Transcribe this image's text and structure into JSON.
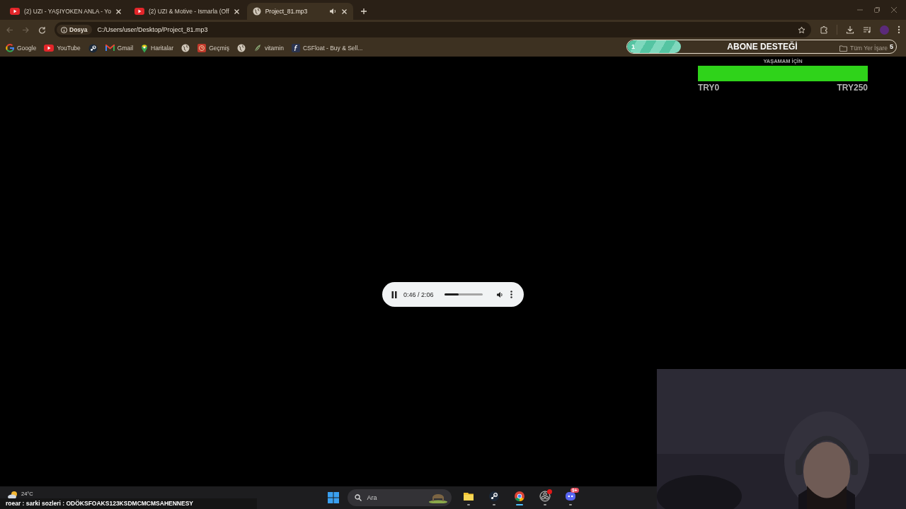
{
  "tabs": [
    {
      "title": "(2) UZI - YAŞIYOKEN ANLA - Yo",
      "kind": "video",
      "selected": false,
      "audio": false
    },
    {
      "title": "(2) UZI & Motive - Ismarla (Off",
      "kind": "video",
      "selected": false,
      "audio": false
    },
    {
      "title": "Project_81.mp3",
      "kind": "file",
      "selected": true,
      "audio": true
    }
  ],
  "address_bar": {
    "chip": "Dosya",
    "url": "C:/Users/user/Desktop/Project_81.mp3"
  },
  "bookmarks": [
    {
      "kind": "google",
      "label": "Google"
    },
    {
      "kind": "video",
      "label": "YouTube"
    },
    {
      "kind": "steam"
    },
    {
      "kind": "mail",
      "label": "Gmail"
    },
    {
      "kind": "pin",
      "label": "Haritalar"
    },
    {
      "kind": "globe"
    },
    {
      "kind": "history",
      "label": "Geçmiş"
    },
    {
      "kind": "globe"
    },
    {
      "kind": "leaf",
      "label": "vitamin"
    },
    {
      "kind": "float",
      "label": "CSFloat - Buy & Sell..."
    }
  ],
  "all_bookmarks": "Tüm Yer İşare",
  "subscriber_goal": {
    "current": "1",
    "title": "ABONE DESTEĞİ",
    "target": "5",
    "level": 0.2
  },
  "donation_goal": {
    "title": "YAŞAMAM İÇİN",
    "level": 1,
    "min": "TRY0",
    "max": "TRY250"
  },
  "player": {
    "playing": true,
    "time": "0:46 / 2:06",
    "level": 0.37
  },
  "taskbar": {
    "temperature": "24°C",
    "search_placeholder": "Ara",
    "apps": [
      {
        "kind": "folder",
        "active": false,
        "alert": false
      },
      {
        "kind": "steam",
        "active": false,
        "alert": false
      },
      {
        "kind": "browser",
        "active": true,
        "alert": false
      },
      {
        "kind": "recorder",
        "active": false,
        "alert": true
      },
      {
        "kind": "chat",
        "active": false,
        "alert": false,
        "badge": "9+"
      }
    ]
  },
  "lyrics": "roear : sarki sozleri : ODÖKSFOAKS123KSDMCMCMSAHENNESY"
}
